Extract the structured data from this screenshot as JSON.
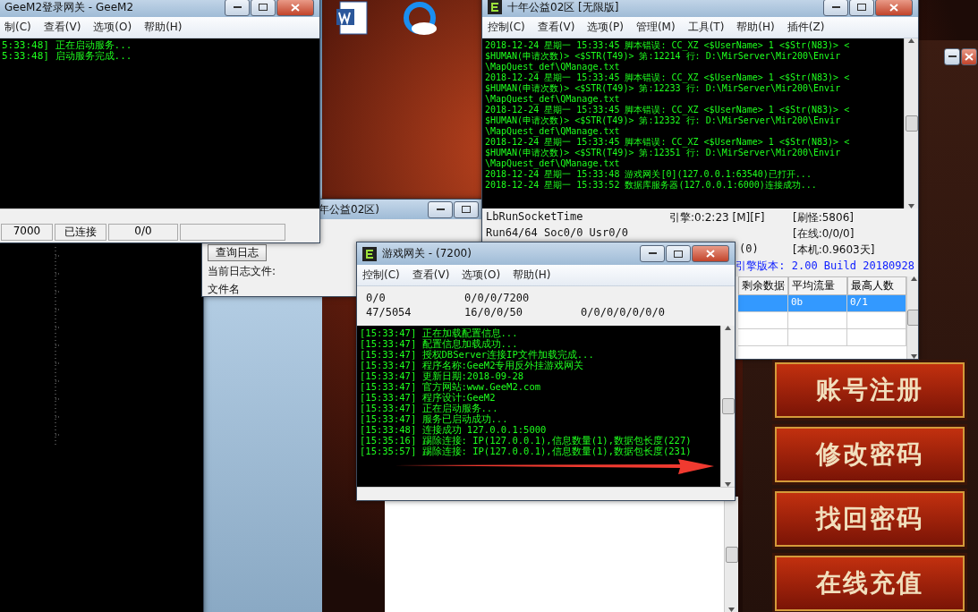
{
  "login_gateway": {
    "title": "GeeM2登录网关 - GeeM2",
    "menu": [
      "制(C)",
      "查看(V)",
      "选项(O)",
      "帮助(H)"
    ],
    "log": [
      "5:33:48] 正在启动服务...",
      "5:33:48] 启动服务完成..."
    ],
    "status_bar": [
      "7000",
      "已连接",
      "0/0"
    ]
  },
  "log_viewer": {
    "title": "年公益02区)",
    "button": "查询日志",
    "current_file_label": "当前日志文件:",
    "file_name_label": "文件名"
  },
  "m2_server": {
    "title": "十年公益02区 [无限版]",
    "menu": [
      "控制(C)",
      "查看(V)",
      "选项(P)",
      "管理(M)",
      "工具(T)",
      "帮助(H)",
      "插件(Z)"
    ],
    "log": [
      "2018-12-24 星期一 15:33:45 脚本错误: CC_XZ <$UserName> 1 <$Str(N83)> <",
      "$HUMAN(申请次数)> <$STR(T49)> 第:12214 行: D:\\MirServer\\Mir200\\Envir",
      "\\MapQuest_def\\QManage.txt",
      "2018-12-24 星期一 15:33:45 脚本错误: CC_XZ <$UserName> 1 <$Str(N83)> <",
      "$HUMAN(申请次数)> <$STR(T49)> 第:12233 行: D:\\MirServer\\Mir200\\Envir",
      "\\MapQuest_def\\QManage.txt",
      "2018-12-24 星期一 15:33:45 脚本错误: CC_XZ <$UserName> 1 <$Str(N83)> <",
      "$HUMAN(申请次数)> <$STR(T49)> 第:12332 行: D:\\MirServer\\Mir200\\Envir",
      "\\MapQuest_def\\QManage.txt",
      "2018-12-24 星期一 15:33:45 脚本错误: CC_XZ <$UserName> 1 <$Str(N83)> <",
      "$HUMAN(申请次数)> <$STR(T49)> 第:12351 行: D:\\MirServer\\Mir200\\Envir",
      "\\MapQuest_def\\QManage.txt",
      "2018-12-24 星期一 15:33:48 游戏网关[0](127.0.0.1:63540)已打开...",
      "2018-12-24 星期一 15:33:52 数据库服务器(127.0.0.1:6000)连接成功..."
    ],
    "status_left": [
      "LbRunSocketTime",
      "Run64/64 Soc0/0 Usr0/0",
      "(0)"
    ],
    "engine_time": "引擎:0:2:23 [M][F]",
    "stats": [
      "[刷怪:5806]",
      "[在线:0/0/0]",
      "[本机:0.9603天]"
    ],
    "version": "引擎版本: 2.00 Build 20180928",
    "table": {
      "columns": [
        "剩余数据",
        "平均流量",
        "最高人数"
      ],
      "rows": [
        {
          "cells": [
            "",
            "0b",
            "0/1"
          ],
          "selected": true
        },
        {
          "cells": [
            "",
            "",
            ""
          ],
          "selected": false
        },
        {
          "cells": [
            "",
            "",
            ""
          ],
          "selected": false
        }
      ]
    }
  },
  "game_gateway": {
    "title": "游戏网关 - (7200)",
    "menu": [
      "控制(C)",
      "查看(V)",
      "选项(O)",
      "帮助(H)"
    ],
    "info": [
      [
        "0/0",
        "0/0/0/7200"
      ],
      [
        "47/5054",
        "16/0/0/50",
        "0/0/0/0/0/0/0"
      ]
    ],
    "log": [
      "[15:33:47] 正在加载配置信息...",
      "[15:33:47] 配置信息加载成功...",
      "[15:33:47] 授权DBServer连接IP文件加载完成...",
      "[15:33:47] 程序名称:GeeM2专用反外挂游戏网关",
      "[15:33:47] 更新日期:2018-09-28",
      "[15:33:47] 官方网站:www.GeeM2.com",
      "[15:33:47] 程序设计:GeeM2",
      "[15:33:47] 正在启动服务...",
      "[15:33:47] 服务已启动成功...",
      "[15:33:48] 连接成功 127.0.0.1:5000",
      "[15:35:16] 踢除连接: IP(127.0.0.1),信息数量(1),数据包长度(227)",
      "[15:35:57] 踢除连接: IP(127.0.0.1),信息数量(1),数据包长度(231)"
    ]
  },
  "game_menu": [
    "账号注册",
    "修改密码",
    "找回密码",
    "在线充值"
  ]
}
